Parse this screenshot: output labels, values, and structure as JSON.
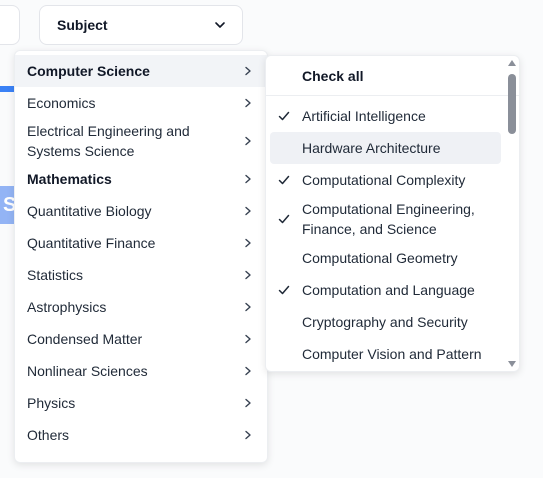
{
  "subject_button": {
    "label": "Subject",
    "icon": "chevron-down-icon"
  },
  "background_stub": {
    "letter": "S"
  },
  "categories": [
    {
      "label": "Computer Science",
      "bold": true,
      "active": true
    },
    {
      "label": "Economics"
    },
    {
      "label": "Electrical Engineering and Systems Science",
      "tall": true
    },
    {
      "label": "Mathematics",
      "bold": true
    },
    {
      "label": "Quantitative Biology"
    },
    {
      "label": "Quantitative Finance"
    },
    {
      "label": "Statistics"
    },
    {
      "label": "Astrophysics"
    },
    {
      "label": "Condensed Matter"
    },
    {
      "label": "Nonlinear Sciences"
    },
    {
      "label": "Physics"
    },
    {
      "label": "Others"
    }
  ],
  "submenu": {
    "check_all_label": "Check all",
    "items": [
      {
        "label": "Artificial Intelligence",
        "checked": true
      },
      {
        "label": "Hardware Architecture",
        "checked": false,
        "hover": true
      },
      {
        "label": "Computational Complexity",
        "checked": true
      },
      {
        "label": "Computational Engineering, Finance, and Science",
        "checked": true,
        "tall": true
      },
      {
        "label": "Computational Geometry",
        "checked": false
      },
      {
        "label": "Computation and Language",
        "checked": true
      },
      {
        "label": "Cryptography and Security",
        "checked": false
      },
      {
        "label": "Computer Vision and Pattern",
        "checked": false
      }
    ]
  },
  "colors": {
    "accent": "#3b82f6",
    "hover_bg": "#eff1f5",
    "active_bg": "#f2f4f7"
  }
}
